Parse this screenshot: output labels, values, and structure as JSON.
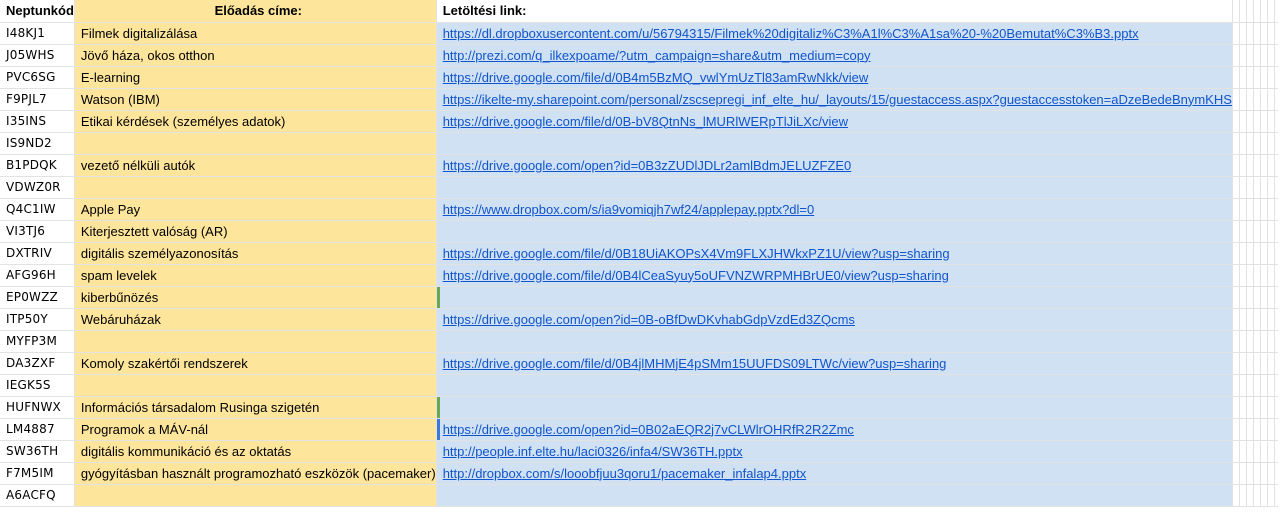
{
  "headers": {
    "neptun": "Neptunkód",
    "title": "Előadás címe:",
    "link": "Letöltési link:"
  },
  "rows": [
    {
      "code": "I48KJ1",
      "title": "Filmek digitalizálása",
      "link": "https://dl.dropboxusercontent.com/u/56794315/Filmek%20digitaliz%C3%A1l%C3%A1sa%20-%20Bemutat%C3%B3.pptx"
    },
    {
      "code": "J05WHS",
      "title": "Jövő háza, okos otthon",
      "link": "http://prezi.com/q_ilkexpoame/?utm_campaign=share&utm_medium=copy"
    },
    {
      "code": "PVC6SG",
      "title": "E-learning",
      "link": "https://drive.google.com/file/d/0B4m5BzMQ_vwlYmUzTl83amRwNkk/view"
    },
    {
      "code": "F9PJL7",
      "title": "Watson (IBM)",
      "link": "https://ikelte-my.sharepoint.com/personal/zscsepregi_inf_elte_hu/_layouts/15/guestaccess.aspx?guestaccesstoken=aDzeBedeBnymKHS"
    },
    {
      "code": "I35INS",
      "title": "Etikai kérdések (személyes adatok)",
      "link": "https://drive.google.com/file/d/0B-bV8QtnNs_lMURlWERpTlJiLXc/view"
    },
    {
      "code": "IS9ND2",
      "title": "",
      "link": ""
    },
    {
      "code": "B1PDQK",
      "title": "vezető nélküli autók",
      "link": "https://drive.google.com/open?id=0B3zZUDlJDLr2amlBdmJELUZFZE0"
    },
    {
      "code": "VDWZ0R",
      "title": "",
      "link": ""
    },
    {
      "code": "Q4C1IW",
      "title": "Apple Pay",
      "link": "https://www.dropbox.com/s/ia9vomiqjh7wf24/applepay.pptx?dl=0"
    },
    {
      "code": "VI3TJ6",
      "title": "Kiterjesztett valóság (AR)",
      "link": ""
    },
    {
      "code": "DXTRIV",
      "title": "digitális személyazonosítás",
      "link": "https://drive.google.com/file/d/0B18UiAKOPsX4Vm9FLXJHWkxPZ1U/view?usp=sharing"
    },
    {
      "code": "AFG96H",
      "title": "spam levelek",
      "link": "https://drive.google.com/file/d/0B4lCeaSyuy5oUFVNZWRPMHBrUE0/view?usp=sharing"
    },
    {
      "code": "EP0WZZ",
      "title": "kiberbűnözés",
      "link": ""
    },
    {
      "code": "ITP50Y",
      "title": "Webáruházak",
      "link": "https://drive.google.com/open?id=0B-oBfDwDKvhabGdpVzdEd3ZQcms"
    },
    {
      "code": "MYFP3M",
      "title": "",
      "link": ""
    },
    {
      "code": "DA3ZXF",
      "title": "Komoly szakértői rendszerek",
      "link": "https://drive.google.com/file/d/0B4jlMHMjE4pSMm15UUFDS09LTWc/view?usp=sharing"
    },
    {
      "code": "IEGK5S",
      "title": "",
      "link": ""
    },
    {
      "code": "HUFNWX",
      "title": "Információs társadalom Rusinga szigetén",
      "link": ""
    },
    {
      "code": "LM4887",
      "title": "Programok a MÁV-nál",
      "link": "https://drive.google.com/open?id=0B02aEQR2j7vCLWlrOHRfR2R2Zmc"
    },
    {
      "code": "SW36TH",
      "title": "digitális kommunikáció és az oktatás",
      "link": "http://people.inf.elte.hu/laci0326/infa4/SW36TH.pptx"
    },
    {
      "code": "F7M5IM",
      "title": "gyógyításban használt programozható eszközök (pacemaker)",
      "link": "http://dropbox.com/s/looobfjuu3qoru1/pacemaker_infalap4.pptx"
    },
    {
      "code": "A6ACFQ",
      "title": "",
      "link": ""
    }
  ]
}
